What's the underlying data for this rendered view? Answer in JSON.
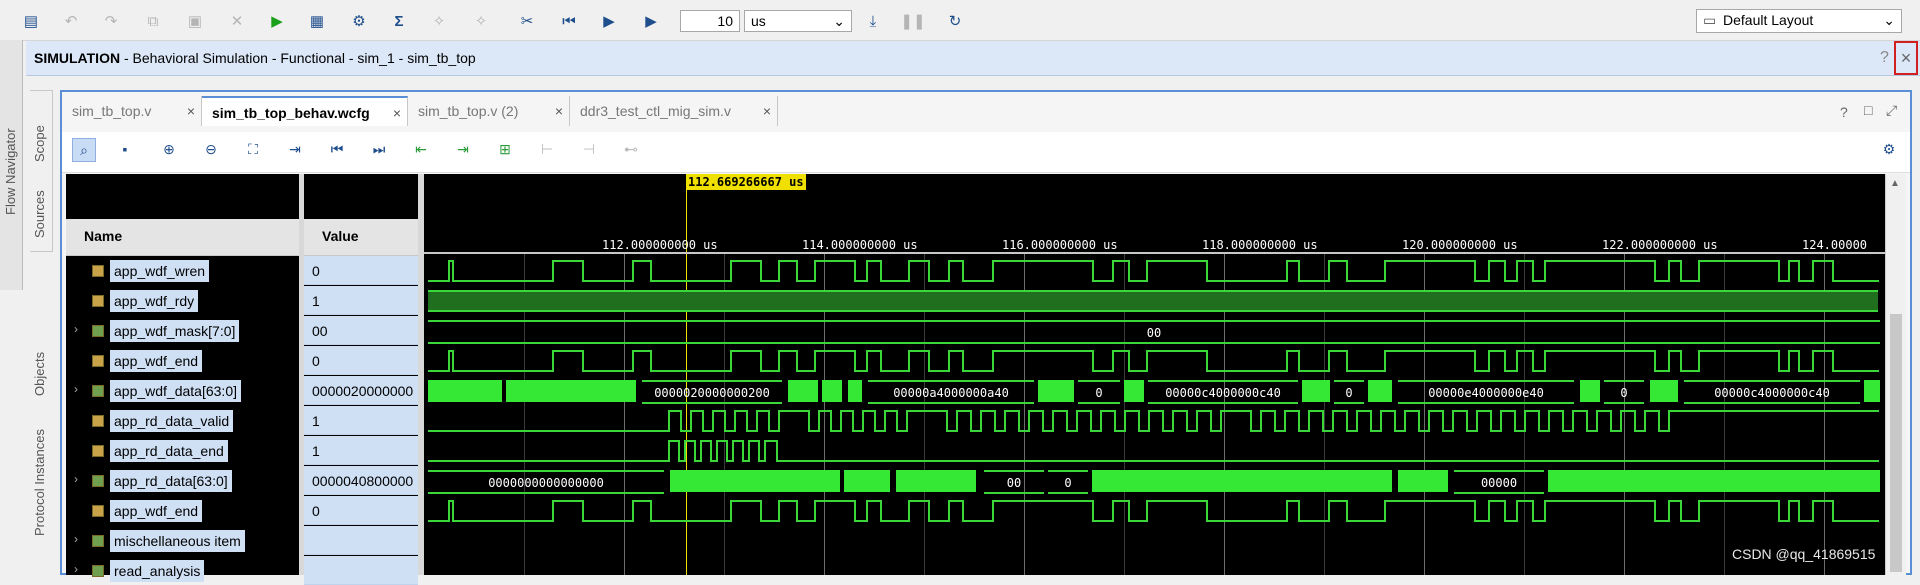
{
  "toolbar": {
    "time_value": "10",
    "time_unit": "us",
    "layout": "Default Layout"
  },
  "sim_header": {
    "bold": "SIMULATION",
    "rest": " - Behavioral Simulation - Functional - sim_1 - sim_tb_top",
    "help": "?",
    "close": "×"
  },
  "side_tabs": {
    "flow_navigator": "Flow Navigator",
    "scope": "Scope",
    "sources": "Sources",
    "objects": "Objects",
    "protocol_instances": "Protocol Instances"
  },
  "tabs": [
    {
      "label": "sim_tb_top.v",
      "close": "×"
    },
    {
      "label": "sim_tb_top_behav.wcfg",
      "close": "×"
    },
    {
      "label": "sim_tb_top.v (2)",
      "close": "×"
    },
    {
      "label": "ddr3_test_ctl_mig_sim.v",
      "close": "×"
    }
  ],
  "panel_controls": {
    "help": "?",
    "restore": "□",
    "maximize": "⤢"
  },
  "columns": {
    "name": "Name",
    "value": "Value"
  },
  "cursor_time": "112.669266667 us",
  "timeline_ticks": [
    "112.000000000 us",
    "114.000000000 us",
    "116.000000000 us",
    "118.000000000 us",
    "120.000000000 us",
    "122.000000000 us",
    "124.00000"
  ],
  "signals": [
    {
      "name": "app_wdf_wren",
      "value": "0",
      "bus": false
    },
    {
      "name": "app_wdf_rdy",
      "value": "1",
      "bus": false
    },
    {
      "name": "app_wdf_mask[7:0]",
      "value": "00",
      "bus": true
    },
    {
      "name": "app_wdf_end",
      "value": "0",
      "bus": false
    },
    {
      "name": "app_wdf_data[63:0]",
      "value": "0000020000000",
      "bus": true
    },
    {
      "name": "app_rd_data_valid",
      "value": "1",
      "bus": false
    },
    {
      "name": "app_rd_data_end",
      "value": "1",
      "bus": false
    },
    {
      "name": "app_rd_data[63:0]",
      "value": "0000040800000",
      "bus": true
    },
    {
      "name": "app_wdf_end",
      "value": "0",
      "bus": false
    },
    {
      "name": "mischellaneous item",
      "value": "",
      "bus": true
    },
    {
      "name": "read_analysis",
      "value": "",
      "bus": true
    }
  ],
  "wave_labels": {
    "mask": "00",
    "wdf_data": [
      "0000020000000200",
      "00000a4000000a40",
      "0",
      "00000c4000000c40",
      "0",
      "00000e4000000e40",
      "0",
      "00000c4000000c40"
    ],
    "rd_data": [
      "0000000000000000",
      "00",
      "0",
      "00000"
    ]
  },
  "watermark": "CSDN @qq_41869515"
}
